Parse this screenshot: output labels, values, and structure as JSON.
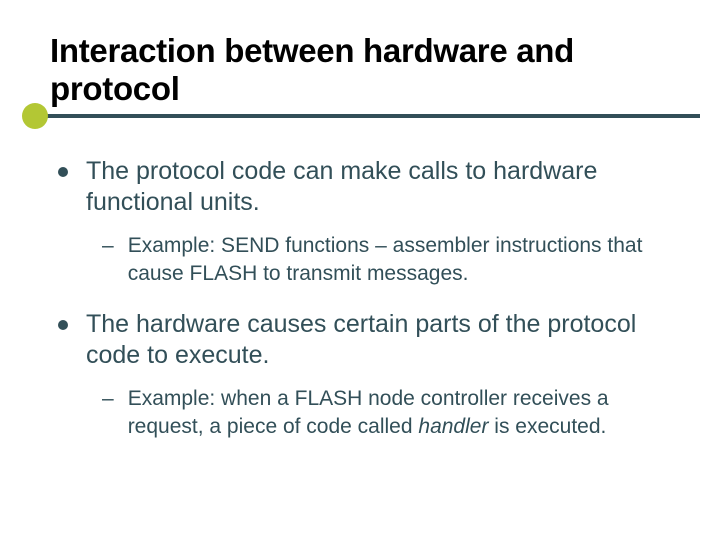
{
  "title": "Interaction between hardware and protocol",
  "bullets": [
    {
      "text": "The protocol code can make calls to hardware functional units.",
      "sub": {
        "prefix": "Example: SEND functions – assembler instructions that cause FLASH to transmit messages."
      }
    },
    {
      "text": "The hardware causes certain parts of the protocol code to execute.",
      "sub": {
        "prefix": "Example: when a FLASH node controller receives a request, a piece of code called ",
        "italic": "handler",
        "suffix": " is executed."
      }
    }
  ]
}
